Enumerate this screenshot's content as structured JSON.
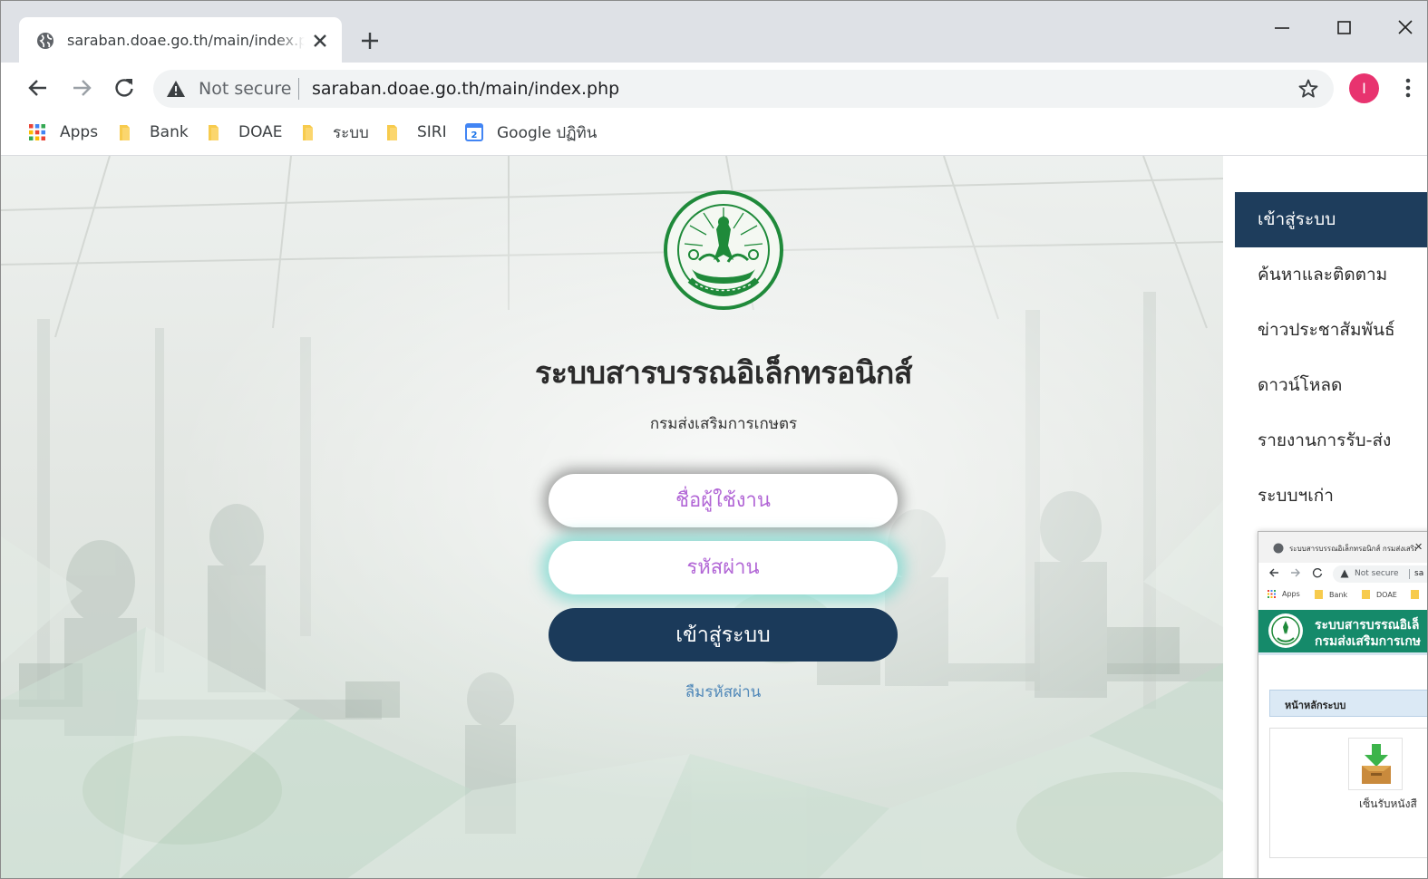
{
  "browser": {
    "tab": {
      "title": "saraban.doae.go.th/main/index.php"
    },
    "address_bar": {
      "security": "Not secure",
      "url": "saraban.doae.go.th/main/index.php"
    },
    "profile_initial": "I",
    "bookmarks": [
      {
        "label": "Apps",
        "icon": "apps-grid-icon"
      },
      {
        "label": "Bank",
        "icon": "folder-icon"
      },
      {
        "label": "DOAE",
        "icon": "folder-icon"
      },
      {
        "label": "ระบบ",
        "icon": "folder-icon"
      },
      {
        "label": "SIRI",
        "icon": "folder-icon"
      },
      {
        "label": "Google ปฏิทิน",
        "icon": "google-calendar-icon"
      }
    ]
  },
  "page": {
    "title": "ระบบสารบรรณอิเล็กทรอนิกส์",
    "subtitle": "กรมส่งเสริมการเกษตร",
    "form": {
      "username_placeholder": "ชื่อผู้ใช้งาน",
      "password_placeholder": "รหัสผ่าน",
      "login_label": "เข้าสู่ระบบ",
      "forgot_label": "ลืมรหัสผ่าน"
    },
    "menu": [
      {
        "label": "เข้าสู่ระบบ",
        "active": true
      },
      {
        "label": "ค้นหาและติดตาม",
        "active": false
      },
      {
        "label": "ข่าวประชาสัมพันธ์",
        "active": false
      },
      {
        "label": "ดาวน์โหลด",
        "active": false
      },
      {
        "label": "รายงานการรับ-ส่ง",
        "active": false
      },
      {
        "label": "ระบบฯเก่า",
        "active": false
      }
    ],
    "preview": {
      "tab_title": "ระบบสารบรรณอิเล็กทรอนิกส์ กรมส่งเสริม",
      "security": "Not secure",
      "url": "sa",
      "bookmarks": [
        "Apps",
        "Bank",
        "DOAE"
      ],
      "header_line1": "ระบบสารบรรณอิเล็",
      "header_line2": "กรมส่งเสริมการเกษ",
      "bar_label": "หน้าหลักระบบ",
      "tile_label": "เซ็นรับหนังสื"
    }
  },
  "colors": {
    "accent_navy": "#1e3d5c",
    "placeholder_purple": "#b267d6",
    "link_blue": "#4f87b8",
    "logo_green": "#1f8a3a",
    "profile_pink": "#e8336f"
  }
}
